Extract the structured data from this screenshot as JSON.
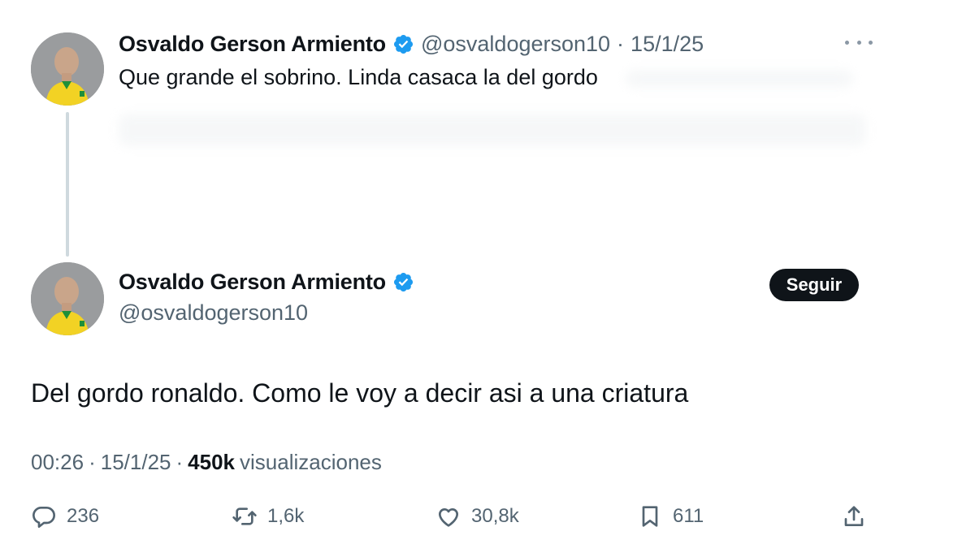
{
  "reply_tweet": {
    "author_name": "Osvaldo Gerson Armiento",
    "handle": "@osvaldogerson10",
    "separator": "·",
    "date": "15/1/25",
    "text": "Que grande el sobrino. Linda casaca la del gordo"
  },
  "main_tweet": {
    "author_name": "Osvaldo Gerson Armiento",
    "handle": "@osvaldogerson10",
    "follow_label": "Seguir",
    "text": "Del gordo ronaldo. Como le voy a decir asi a una criatura",
    "time": "00:26",
    "sep1": "·",
    "date": "15/1/25",
    "sep2": "·",
    "views_count": "450k",
    "views_label": "visualizaciones"
  },
  "actions": {
    "replies": "236",
    "retweets": "1,6k",
    "likes": "30,8k",
    "bookmarks": "611"
  },
  "colors": {
    "verified": "#1d9bf0",
    "secondary_text": "#536471",
    "primary_text": "#0f1419",
    "thread_line": "#cfd9de"
  },
  "icons": [
    "verified-badge-icon",
    "more-icon",
    "reply-icon",
    "retweet-icon",
    "like-icon",
    "bookmark-icon",
    "share-icon"
  ]
}
